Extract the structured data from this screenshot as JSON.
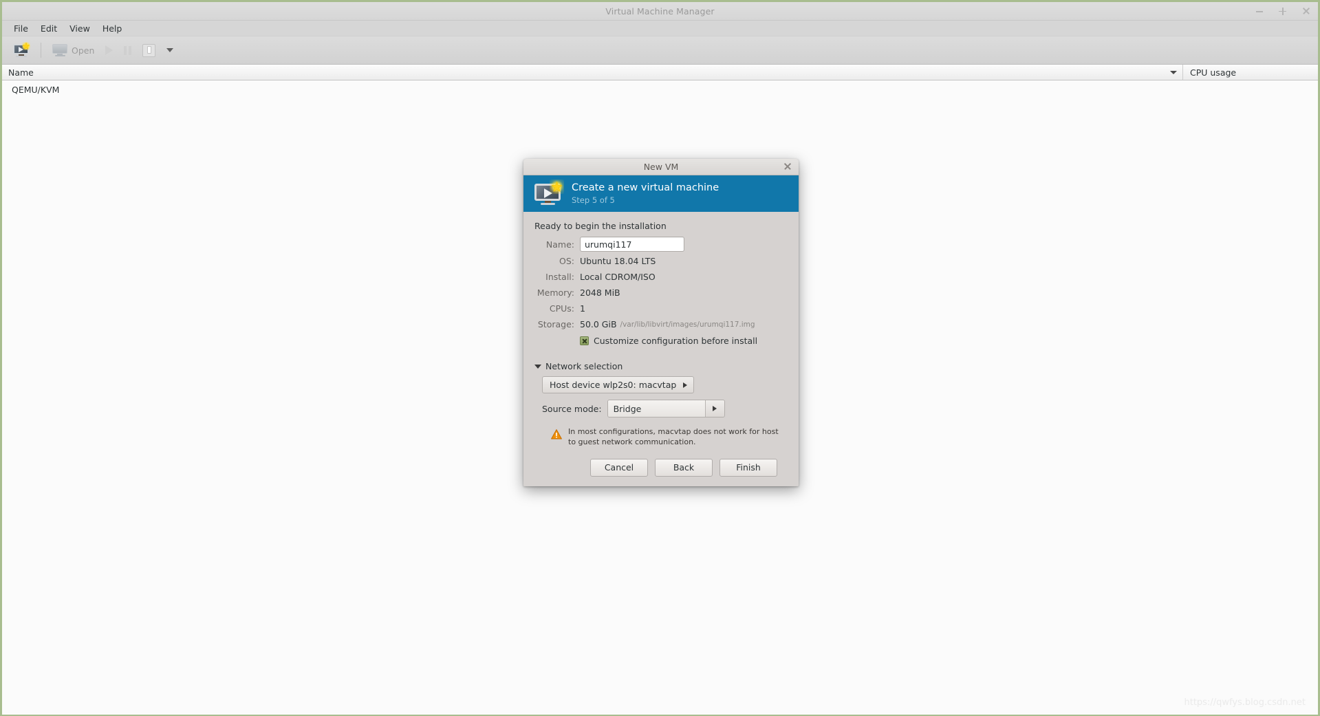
{
  "window": {
    "title": "Virtual Machine Manager",
    "controls": {
      "minimize": "minimize",
      "maximize": "maximize",
      "close": "close"
    }
  },
  "menubar": {
    "items": [
      {
        "label": "File"
      },
      {
        "label": "Edit"
      },
      {
        "label": "View"
      },
      {
        "label": "Help"
      }
    ]
  },
  "toolbar": {
    "new_vm_tooltip": "Create a new virtual machine",
    "open_label": "Open",
    "run_tooltip": "Run",
    "pause_tooltip": "Pause",
    "shutdown_tooltip": "Shut down",
    "menu_tooltip": "More options"
  },
  "columns": {
    "name": "Name",
    "cpu_usage": "CPU usage"
  },
  "vm_list": {
    "rows": [
      {
        "name": "QEMU/KVM",
        "cpu_usage": ""
      }
    ]
  },
  "watermark": "https://qwfys.blog.csdn.net",
  "dialog": {
    "title": "New VM",
    "header": {
      "heading": "Create a new virtual machine",
      "step": "Step 5 of 5"
    },
    "ready_text": "Ready to begin the installation",
    "fields": {
      "name_label": "Name:",
      "name_value": "urumqi117",
      "name_placeholder": "",
      "os_label": "OS:",
      "os_value": "Ubuntu 18.04 LTS",
      "install_label": "Install:",
      "install_value": "Local CDROM/ISO",
      "memory_label": "Memory:",
      "memory_value": "2048 MiB",
      "cpus_label": "CPUs:",
      "cpus_value": "1",
      "storage_label": "Storage:",
      "storage_value": "50.0 GiB",
      "storage_path": "/var/lib/libvirt/images/urumqi117.img"
    },
    "customize": {
      "label": "Customize configuration before install",
      "checked": true
    },
    "network": {
      "section_label": "Network selection",
      "device_value": "Host device wlp2s0: macvtap",
      "source_mode_label": "Source mode:",
      "source_mode_value": "Bridge",
      "warning": "In most configurations, macvtap does not work for host to guest network communication."
    },
    "buttons": {
      "cancel": "Cancel",
      "back": "Back",
      "finish": "Finish"
    }
  },
  "colors": {
    "header_blue": "#1177aa",
    "window_accent": "#a8bd8f",
    "checkbox_green": "#8aa05f",
    "warning_orange": "#f0900a"
  }
}
